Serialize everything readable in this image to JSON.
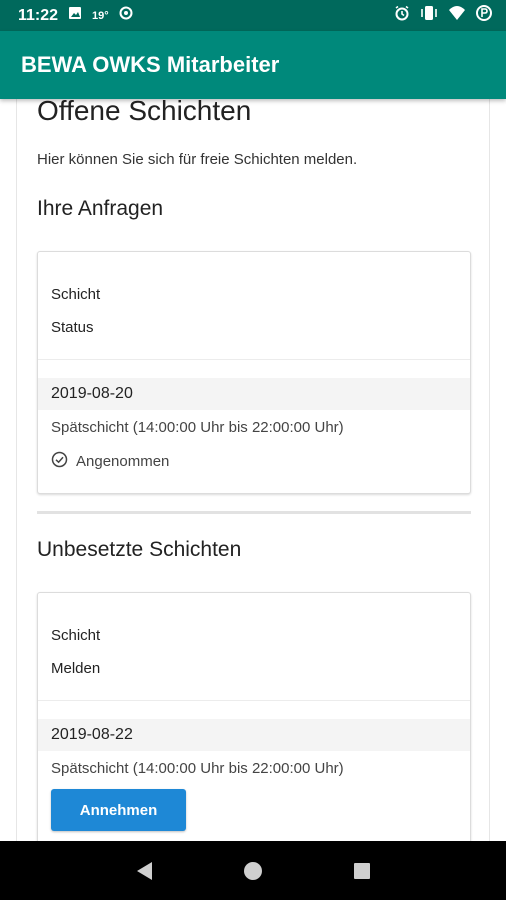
{
  "status_bar": {
    "time": "11:22",
    "temperature": "19°",
    "icons": [
      "image-icon",
      "target-icon",
      "alarm-icon",
      "vibrate-icon",
      "wifi-icon",
      "battery-icon"
    ]
  },
  "app_bar": {
    "title": "BEWA OWKS Mitarbeiter"
  },
  "page": {
    "title": "Offene Schichten",
    "intro": "Hier können Sie sich für freie Schichten melden."
  },
  "requests": {
    "heading": "Ihre Anfragen",
    "col_shift": "Schicht",
    "col_status": "Status",
    "items": [
      {
        "date": "2019-08-20",
        "shift": "Spätschicht (14:00:00 Uhr bis 22:00:00 Uhr)",
        "status": "Angenommen"
      }
    ]
  },
  "open_shifts": {
    "heading": "Unbesetzte Schichten",
    "col_shift": "Schicht",
    "col_report": "Melden",
    "items": [
      {
        "date": "2019-08-22",
        "shift": "Spätschicht (14:00:00 Uhr bis 22:00:00 Uhr)",
        "action_label": "Annehmen"
      }
    ]
  },
  "colors": {
    "status_bar": "#00695c",
    "app_bar": "#00897b",
    "button": "#1e88d6",
    "nav_bar": "#000000"
  },
  "nav_bar": {
    "icons": [
      "back-icon",
      "home-icon",
      "recents-icon"
    ]
  }
}
